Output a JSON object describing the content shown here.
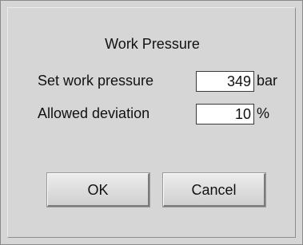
{
  "dialog": {
    "title": "Work Pressure",
    "fields": [
      {
        "label": "Set work pressure",
        "value": "349",
        "unit": "bar"
      },
      {
        "label": "Allowed deviation",
        "value": "10",
        "unit": "%"
      }
    ],
    "buttons": {
      "ok_label": "OK",
      "cancel_label": "Cancel"
    }
  }
}
